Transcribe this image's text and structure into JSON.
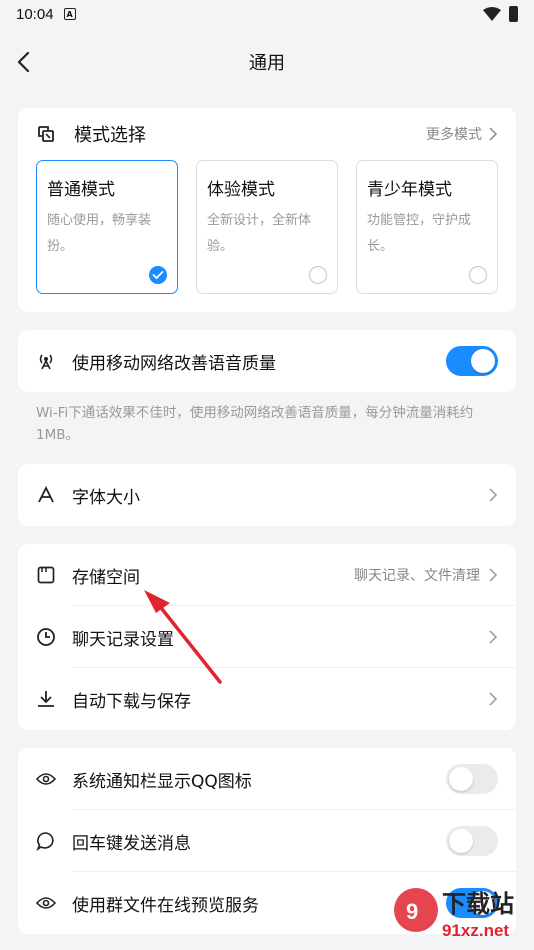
{
  "status": {
    "time": "10:04",
    "notif_letter": "A"
  },
  "nav": {
    "title": "通用"
  },
  "mode": {
    "title": "模式选择",
    "more": "更多模式",
    "options": [
      {
        "name": "普通模式",
        "desc": "随心使用，畅享装扮。",
        "selected": true
      },
      {
        "name": "体验模式",
        "desc": "全新设计，全新体验。",
        "selected": false
      },
      {
        "name": "青少年模式",
        "desc": "功能管控，守护成长。",
        "selected": false
      }
    ]
  },
  "voice": {
    "label": "使用移动网络改善语音质量",
    "enabled": true,
    "hint": "Wi-Fi下通话效果不佳时，使用移动网络改善语音质量，每分钟流量消耗约1MB。"
  },
  "font": {
    "label": "字体大小"
  },
  "storage": {
    "storage_label": "存储空间",
    "storage_detail": "聊天记录、文件清理",
    "chat_label": "聊天记录设置",
    "download_label": "自动下载与保存"
  },
  "toggles": [
    {
      "label": "系统通知栏显示QQ图标",
      "enabled": false
    },
    {
      "label": "回车键发送消息",
      "enabled": false
    },
    {
      "label": "使用群文件在线预览服务",
      "enabled": true
    }
  ],
  "watermark": {
    "text1": "下载站",
    "text2": "91xz.net"
  },
  "colors": {
    "accent": "#1a8cff",
    "arrow": "#e0242f",
    "background": "#f3f4f6"
  }
}
